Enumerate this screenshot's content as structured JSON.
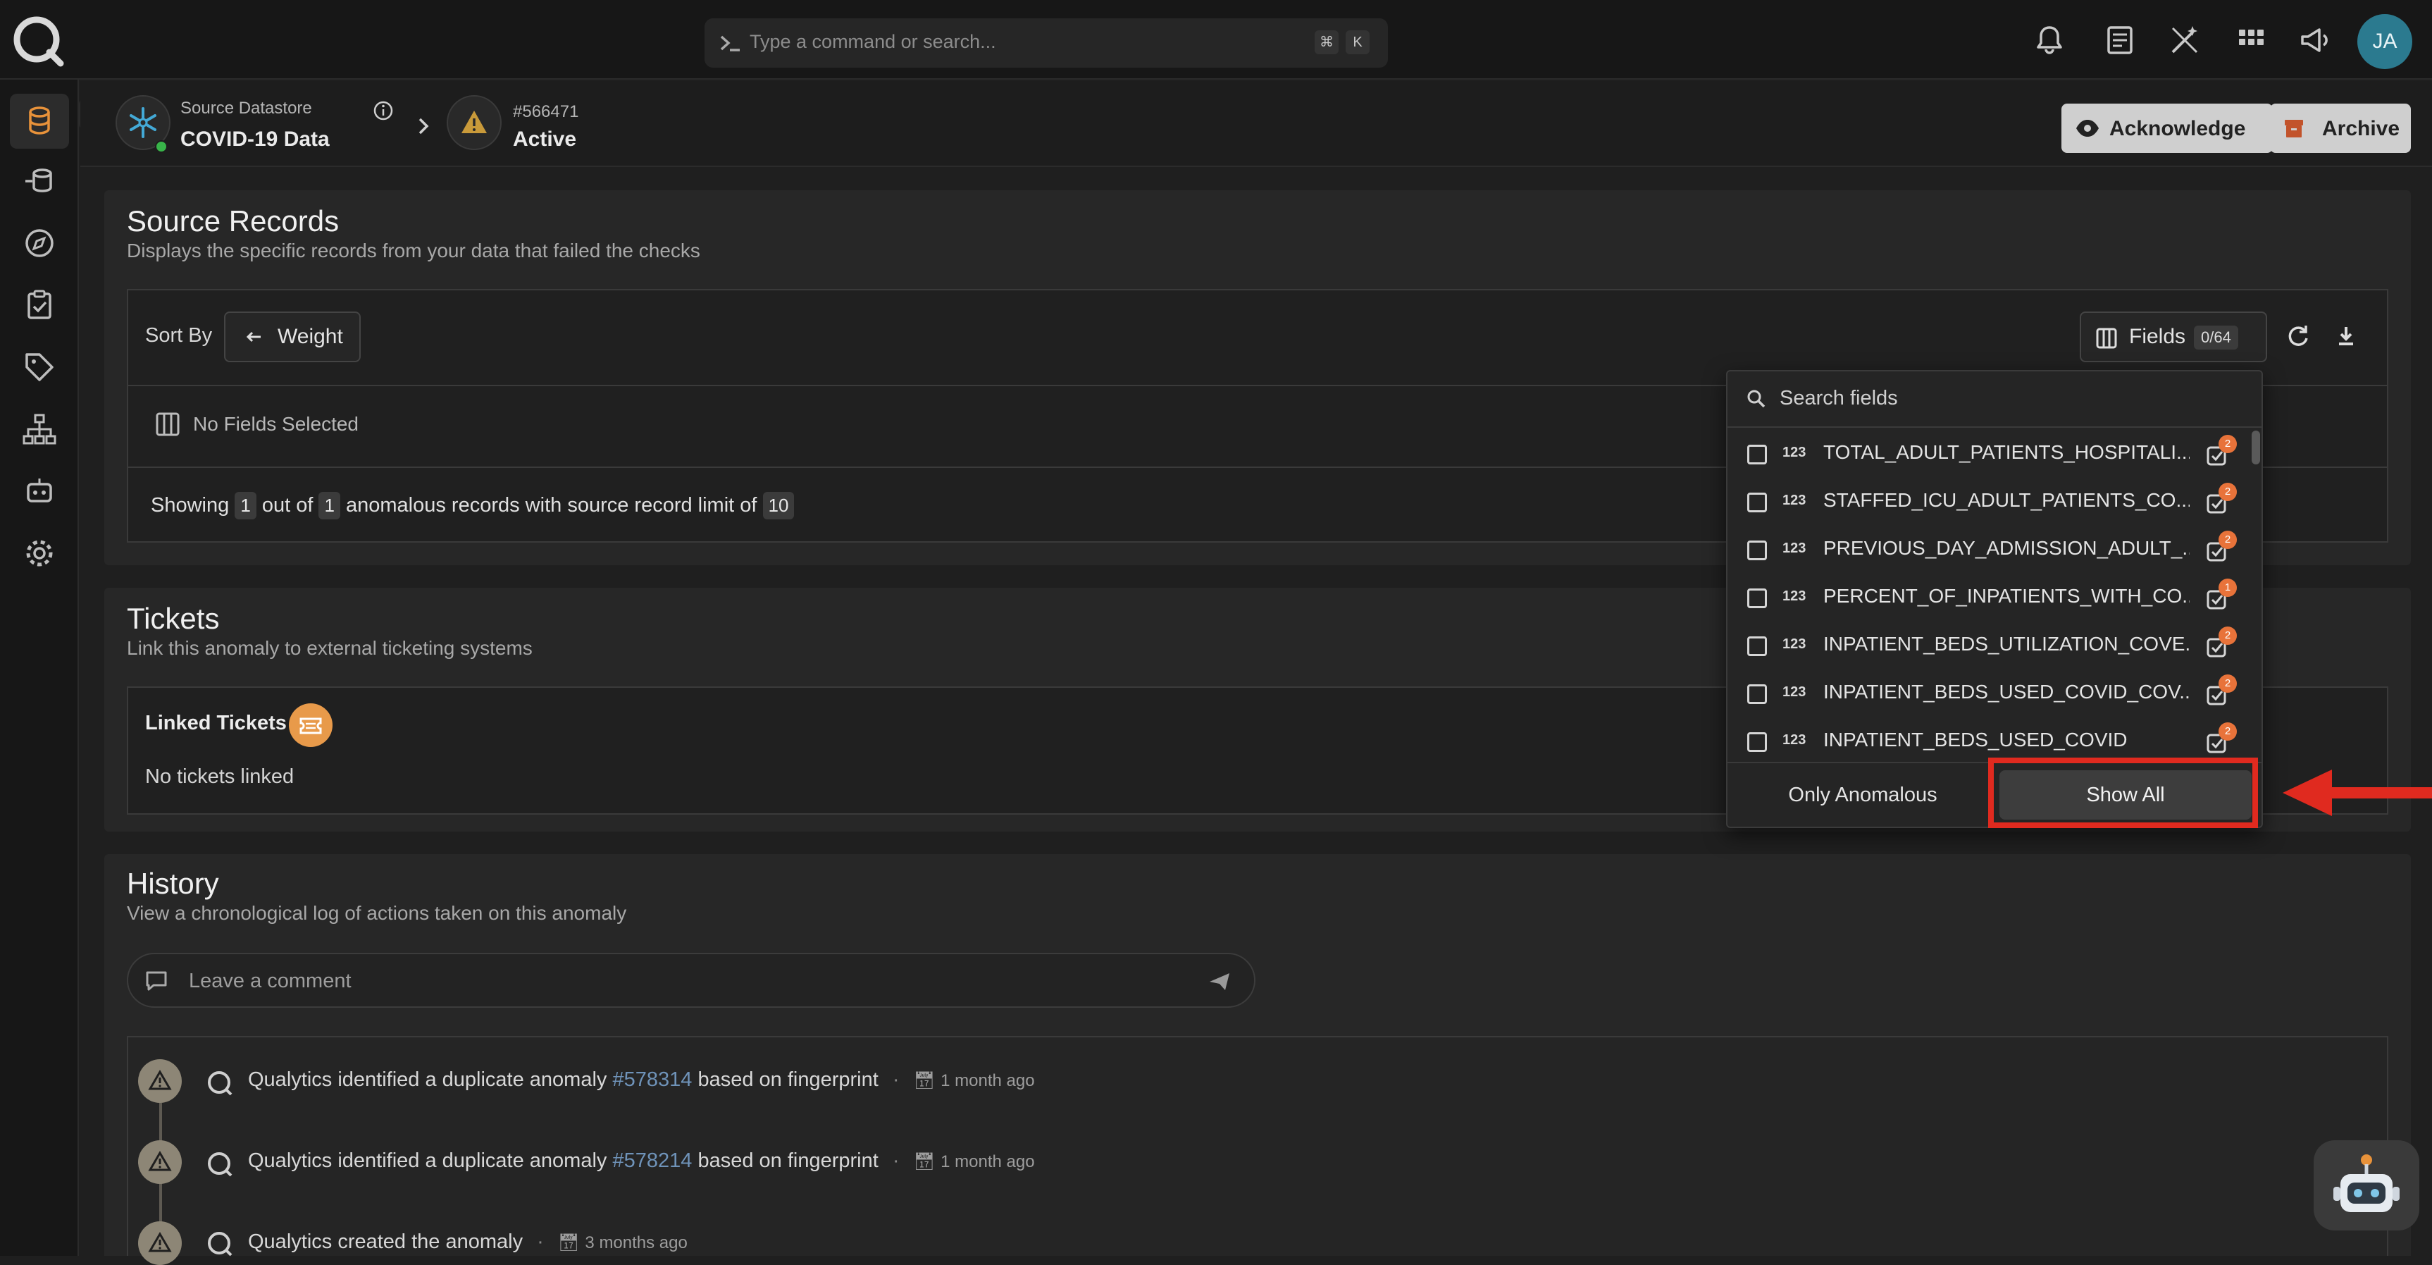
{
  "colors": {
    "accent": "#e8733a",
    "link": "#6f93b9",
    "highlight": "#e02a1f",
    "avatar": "#2b7a8f"
  },
  "topbar": {
    "command_placeholder": "Type a command or search...",
    "shortcut_keys": [
      "⌘",
      "K"
    ],
    "icons": [
      "bell-icon",
      "document-icon",
      "magic-wand-icon",
      "grid-icon",
      "megaphone-icon"
    ],
    "avatar_initials": "JA"
  },
  "sidebar": {
    "items": [
      "database-icon",
      "datastore-icon",
      "compass-icon",
      "clipboard-check-icon",
      "tag-icon",
      "hierarchy-icon",
      "robot-icon",
      "gear-icon"
    ]
  },
  "header": {
    "source_label": "Source Datastore",
    "source_name": "COVID-19 Data",
    "anomaly_id": "#566471",
    "status": "Active",
    "acknowledge_label": "Acknowledge",
    "archive_label": "Archive"
  },
  "source_records": {
    "title": "Source Records",
    "subtitle": "Displays the specific records from your data that failed the checks",
    "sort_by_label": "Sort By",
    "sort_value": "Weight",
    "fields_label": "Fields",
    "fields_count": "0/64",
    "no_fields": "No Fields Selected",
    "showing_prefix": "Showing",
    "shown_count": "1",
    "out_of": "out of",
    "total_count": "1",
    "anomalous_text": "anomalous records with source record limit of",
    "limit": "10"
  },
  "fields_dropdown": {
    "search_placeholder": "Search fields",
    "type_label": "123",
    "fields": [
      {
        "name": "TOTAL_ADULT_PATIENTS_HOSPITALI...",
        "checks": "2"
      },
      {
        "name": "STAFFED_ICU_ADULT_PATIENTS_CO...",
        "checks": "2"
      },
      {
        "name": "PREVIOUS_DAY_ADMISSION_ADULT_...",
        "checks": "2"
      },
      {
        "name": "PERCENT_OF_INPATIENTS_WITH_CO...",
        "checks": "1"
      },
      {
        "name": "INPATIENT_BEDS_UTILIZATION_COVE...",
        "checks": "2"
      },
      {
        "name": "INPATIENT_BEDS_USED_COVID_COV...",
        "checks": "2"
      },
      {
        "name": "INPATIENT_BEDS_USED_COVID",
        "checks": "2"
      }
    ],
    "only_anomalous_label": "Only Anomalous",
    "show_all_label": "Show All"
  },
  "tickets": {
    "title": "Tickets",
    "subtitle": "Link this anomaly to external ticketing systems",
    "linked_label": "Linked Tickets",
    "empty_text": "No tickets linked"
  },
  "history": {
    "title": "History",
    "subtitle": "View a chronological log of actions taken on this anomaly",
    "comment_placeholder": "Leave a comment",
    "entries": [
      {
        "prefix": "Qualytics identified a duplicate anomaly",
        "link": "#578314",
        "suffix": "based on fingerprint",
        "time": "1 month ago"
      },
      {
        "prefix": "Qualytics identified a duplicate anomaly",
        "link": "#578214",
        "suffix": "based on fingerprint",
        "time": "1 month ago"
      },
      {
        "prefix": "Qualytics created the anomaly",
        "link": "",
        "suffix": "",
        "time": "3 months ago"
      }
    ]
  }
}
